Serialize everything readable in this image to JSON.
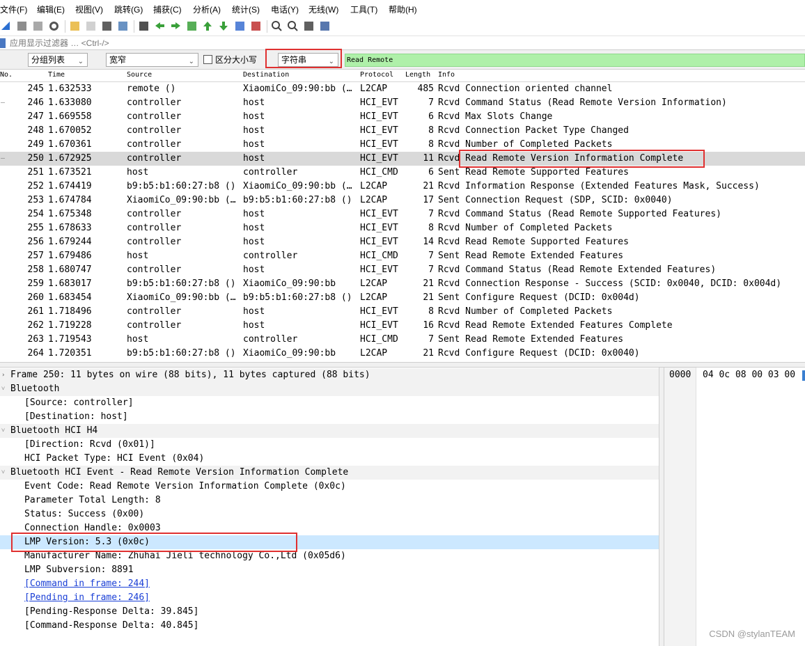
{
  "menu": [
    "文件(F)",
    "编辑(E)",
    "视图(V)",
    "跳转(G)",
    "捕获(C)",
    "分析(A)",
    "统计(S)",
    "电话(Y)",
    "无线(W)",
    "工具(T)",
    "帮助(H)"
  ],
  "toolbar_icons": [
    "shark-fin-start-icon",
    "stop-icon",
    "restart-icon",
    "options-gear-icon",
    "open-folder-icon",
    "save-icon",
    "close-file-icon",
    "reload-icon",
    "find-packet-icon",
    "go-back-icon",
    "go-forward-icon",
    "go-to-packet-icon",
    "first-packet-icon",
    "last-packet-icon",
    "auto-scroll-icon",
    "colorize-icon",
    "zoom-in-icon",
    "zoom-out-icon",
    "normal-size-icon",
    "resize-columns-icon"
  ],
  "display_filter": {
    "placeholder": "应用显示过滤器 … <Ctrl-/>"
  },
  "find_bar": {
    "search_in": "分组列表",
    "char_width": "宽窄",
    "case_sensitive_label": "区分大小写",
    "search_type": "字符串",
    "search_text": "Read Remote"
  },
  "packet_list": {
    "columns": [
      "No.",
      "Time",
      "Source",
      "Destination",
      "Protocol",
      "Length",
      "Info"
    ],
    "rows": [
      {
        "no": "245",
        "time": "1.632533",
        "src": "remote ()",
        "dst": "XiaomiCo_09:90:bb (…",
        "proto": "L2CAP",
        "len": "485",
        "info": "Rcvd Connection oriented channel",
        "mark": ""
      },
      {
        "no": "246",
        "time": "1.633080",
        "src": "controller",
        "dst": "host",
        "proto": "HCI_EVT",
        "len": "7",
        "info": "Rcvd Command Status (Read Remote Version Information)",
        "mark": "—"
      },
      {
        "no": "247",
        "time": "1.669558",
        "src": "controller",
        "dst": "host",
        "proto": "HCI_EVT",
        "len": "6",
        "info": "Rcvd Max Slots Change",
        "mark": ""
      },
      {
        "no": "248",
        "time": "1.670052",
        "src": "controller",
        "dst": "host",
        "proto": "HCI_EVT",
        "len": "8",
        "info": "Rcvd Connection Packet Type Changed",
        "mark": ""
      },
      {
        "no": "249",
        "time": "1.670361",
        "src": "controller",
        "dst": "host",
        "proto": "HCI_EVT",
        "len": "8",
        "info": "Rcvd Number of Completed Packets",
        "mark": ""
      },
      {
        "no": "250",
        "time": "1.672925",
        "src": "controller",
        "dst": "host",
        "proto": "HCI_EVT",
        "len": "11",
        "info": "Rcvd Read Remote Version Information Complete",
        "mark": "—"
      },
      {
        "no": "251",
        "time": "1.673521",
        "src": "host",
        "dst": "controller",
        "proto": "HCI_CMD",
        "len": "6",
        "info": "Sent Read Remote Supported Features",
        "mark": ""
      },
      {
        "no": "252",
        "time": "1.674419",
        "src": "b9:b5:b1:60:27:b8 ()",
        "dst": "XiaomiCo_09:90:bb (…",
        "proto": "L2CAP",
        "len": "21",
        "info": "Rcvd Information Response (Extended Features Mask, Success)",
        "mark": ""
      },
      {
        "no": "253",
        "time": "1.674784",
        "src": "XiaomiCo_09:90:bb (…",
        "dst": "b9:b5:b1:60:27:b8 ()",
        "proto": "L2CAP",
        "len": "17",
        "info": "Sent Connection Request (SDP, SCID: 0x0040)",
        "mark": ""
      },
      {
        "no": "254",
        "time": "1.675348",
        "src": "controller",
        "dst": "host",
        "proto": "HCI_EVT",
        "len": "7",
        "info": "Rcvd Command Status (Read Remote Supported Features)",
        "mark": ""
      },
      {
        "no": "255",
        "time": "1.678633",
        "src": "controller",
        "dst": "host",
        "proto": "HCI_EVT",
        "len": "8",
        "info": "Rcvd Number of Completed Packets",
        "mark": ""
      },
      {
        "no": "256",
        "time": "1.679244",
        "src": "controller",
        "dst": "host",
        "proto": "HCI_EVT",
        "len": "14",
        "info": "Rcvd Read Remote Supported Features",
        "mark": ""
      },
      {
        "no": "257",
        "time": "1.679486",
        "src": "host",
        "dst": "controller",
        "proto": "HCI_CMD",
        "len": "7",
        "info": "Sent Read Remote Extended Features",
        "mark": ""
      },
      {
        "no": "258",
        "time": "1.680747",
        "src": "controller",
        "dst": "host",
        "proto": "HCI_EVT",
        "len": "7",
        "info": "Rcvd Command Status (Read Remote Extended Features)",
        "mark": ""
      },
      {
        "no": "259",
        "time": "1.683017",
        "src": "b9:b5:b1:60:27:b8 ()",
        "dst": "XiaomiCo_09:90:bb",
        "proto": "L2CAP",
        "len": "21",
        "info": "Rcvd Connection Response - Success (SCID: 0x0040, DCID: 0x004d)",
        "mark": ""
      },
      {
        "no": "260",
        "time": "1.683454",
        "src": "XiaomiCo_09:90:bb (…",
        "dst": "b9:b5:b1:60:27:b8 ()",
        "proto": "L2CAP",
        "len": "21",
        "info": "Sent Configure Request (DCID: 0x004d)",
        "mark": ""
      },
      {
        "no": "261",
        "time": "1.718496",
        "src": "controller",
        "dst": "host",
        "proto": "HCI_EVT",
        "len": "8",
        "info": "Rcvd Number of Completed Packets",
        "mark": ""
      },
      {
        "no": "262",
        "time": "1.719228",
        "src": "controller",
        "dst": "host",
        "proto": "HCI_EVT",
        "len": "16",
        "info": "Rcvd Read Remote Extended Features Complete",
        "mark": ""
      },
      {
        "no": "263",
        "time": "1.719543",
        "src": "host",
        "dst": "controller",
        "proto": "HCI_CMD",
        "len": "7",
        "info": "Sent Read Remote Extended Features",
        "mark": ""
      },
      {
        "no": "264",
        "time": "1.720351",
        "src": "b9:b5:b1:60:27:b8 ()",
        "dst": "XiaomiCo_09:90:bb",
        "proto": "L2CAP",
        "len": "21",
        "info": "Rcvd Configure Request (DCID: 0x0040)",
        "mark": ""
      }
    ],
    "selected_no": "250"
  },
  "details": [
    {
      "text": "Frame 250: 11 bytes on wire (88 bits), 11 bytes captured (88 bits)",
      "arrow": "›",
      "indent": 0,
      "kind": "sect"
    },
    {
      "text": "Bluetooth",
      "arrow": "˅",
      "indent": 0,
      "kind": "sect"
    },
    {
      "text": "[Source: controller]",
      "arrow": "",
      "indent": 1,
      "kind": ""
    },
    {
      "text": "[Destination: host]",
      "arrow": "",
      "indent": 1,
      "kind": ""
    },
    {
      "text": "Bluetooth HCI H4",
      "arrow": "˅",
      "indent": 0,
      "kind": "sect"
    },
    {
      "text": "[Direction: Rcvd (0x01)]",
      "arrow": "",
      "indent": 1,
      "kind": ""
    },
    {
      "text": "HCI Packet Type: HCI Event (0x04)",
      "arrow": "",
      "indent": 1,
      "kind": ""
    },
    {
      "text": "Bluetooth HCI Event - Read Remote Version Information Complete",
      "arrow": "˅",
      "indent": 0,
      "kind": "sect"
    },
    {
      "text": "Event Code: Read Remote Version Information Complete (0x0c)",
      "arrow": "",
      "indent": 1,
      "kind": ""
    },
    {
      "text": "Parameter Total Length: 8",
      "arrow": "",
      "indent": 1,
      "kind": ""
    },
    {
      "text": "Status: Success (0x00)",
      "arrow": "",
      "indent": 1,
      "kind": ""
    },
    {
      "text": "Connection Handle: 0x0003",
      "arrow": "",
      "indent": 1,
      "kind": ""
    },
    {
      "text": "LMP Version: 5.3 (0x0c)",
      "arrow": "",
      "indent": 1,
      "kind": "hl"
    },
    {
      "text": "Manufacturer Name: Zhuhai Jieli technology Co.,Ltd (0x05d6)",
      "arrow": "",
      "indent": 1,
      "kind": ""
    },
    {
      "text": "LMP Subversion: 8891",
      "arrow": "",
      "indent": 1,
      "kind": ""
    },
    {
      "text": "[Command in frame: 244]",
      "arrow": "",
      "indent": 1,
      "kind": "link"
    },
    {
      "text": "[Pending in frame: 246]",
      "arrow": "",
      "indent": 1,
      "kind": "link"
    },
    {
      "text": "[Pending-Response Delta: 39.845]",
      "arrow": "",
      "indent": 1,
      "kind": ""
    },
    {
      "text": "[Command-Response Delta: 40.845]",
      "arrow": "",
      "indent": 1,
      "kind": ""
    }
  ],
  "hex": {
    "offset": "0000",
    "bytes": "04 0c 08 00 03 00"
  },
  "watermark": "CSDN @stylanTEAM",
  "colors": {
    "search_field_bg": "#aff0a9",
    "selected_row_bg": "#d9d9d9",
    "highlight_field_bg": "#cce8ff",
    "annotation_box": "#e03030",
    "link": "#1a3fd6"
  }
}
